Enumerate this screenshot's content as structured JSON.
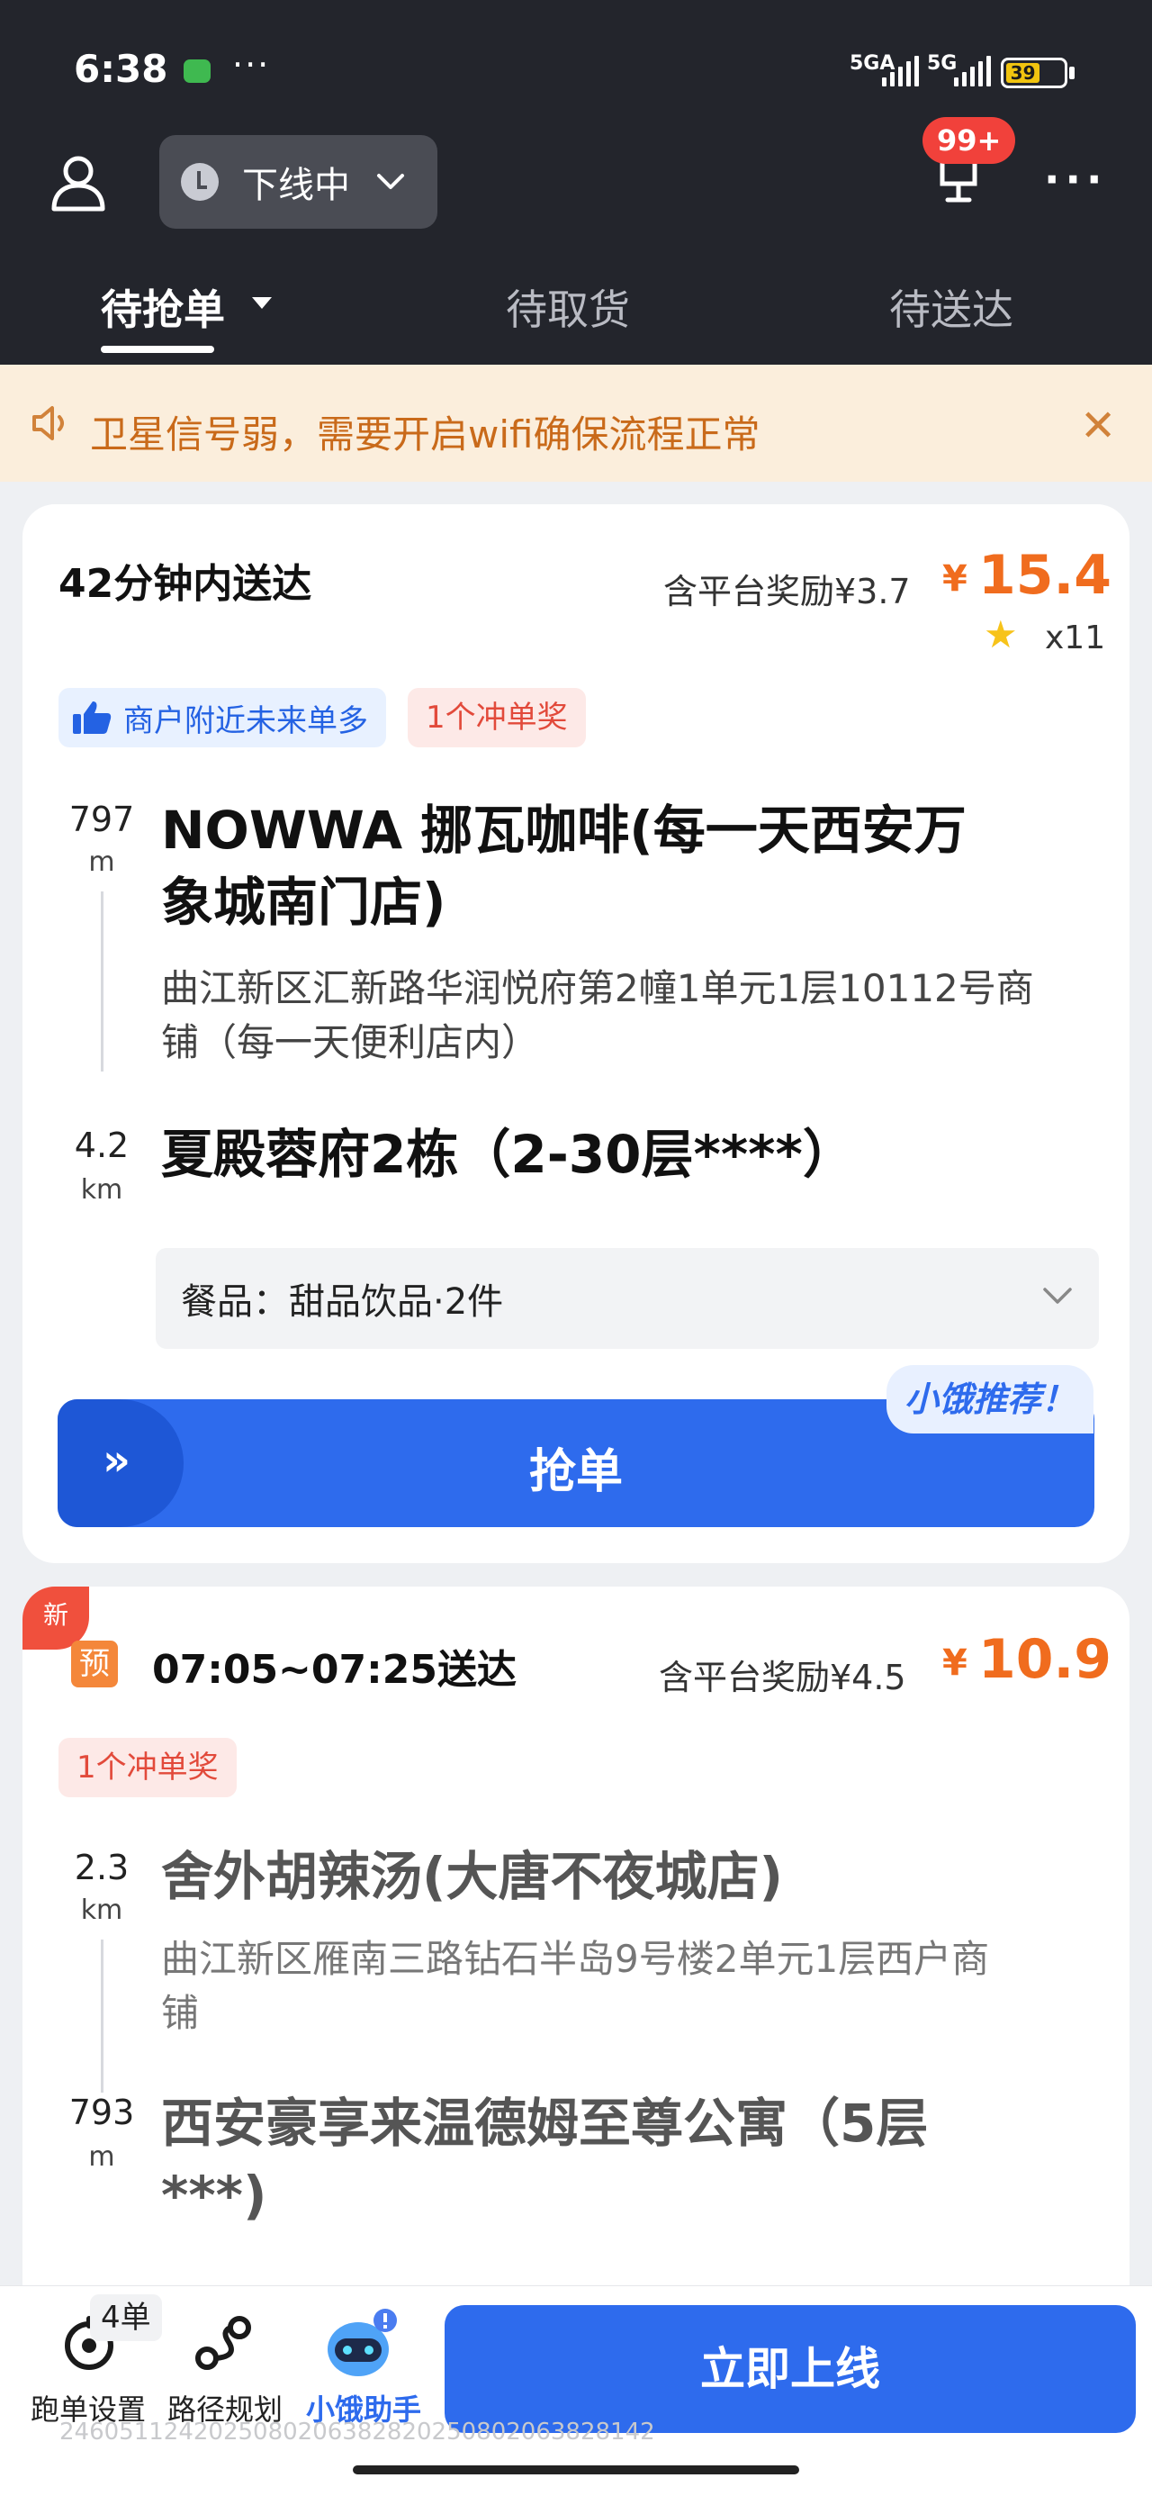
{
  "status_bar": {
    "time": "6:38",
    "dots": "···",
    "net1": "5GA",
    "net2": "5G",
    "battery": "39"
  },
  "header": {
    "status_label": "下线中",
    "badge": "99+",
    "more": "···"
  },
  "tabs": [
    {
      "label": "待抢单"
    },
    {
      "label": "待取货"
    },
    {
      "label": "待送达"
    }
  ],
  "notice": {
    "text": "卫星信号弱，需要开启wifi确保流程正常",
    "close": "✕"
  },
  "orders": [
    {
      "deliver": "42分钟内送达",
      "bonus": "含平台奖励¥3.7",
      "yen": "¥",
      "price": "15.4",
      "stars": "x11",
      "tags": [
        "商户附近未来单多",
        "1个冲单奖"
      ],
      "pickup": {
        "dist": "797",
        "unit": "m",
        "name_line1": "NOWWA 挪瓦咖啡(每一天西安万",
        "name_line2": "象城南门店)",
        "addr_line1": "曲江新区汇新路华润悦府第2幢1单元1层10112号商",
        "addr_line2": "铺（每一天便利店内）"
      },
      "dropoff": {
        "dist": "4.2",
        "unit": "km",
        "name": "夏殿蓉府2栋（2-30层****）"
      },
      "items": "餐品：甜品饮品·2件",
      "grab": "抢单",
      "recommend": "小饿推荐！"
    },
    {
      "new_flag": "新",
      "pre_flag": "预",
      "deliver": "07:05~07:25送达",
      "bonus": "含平台奖励¥4.5",
      "yen": "¥",
      "price": "10.9",
      "tags": [
        "1个冲单奖"
      ],
      "pickup": {
        "dist": "2.3",
        "unit": "km",
        "name": "舍外胡辣汤(大唐不夜城店)",
        "addr_line1": "曲江新区雁南三路钻石半岛9号楼2单元1层西户商",
        "addr_line2": "铺"
      },
      "dropoff": {
        "dist": "793",
        "unit": "m",
        "name_line1": "西安豪享来温德姆至尊公寓（5层",
        "name_line2": "***)"
      }
    }
  ],
  "bottom": {
    "count": "4单",
    "settings": "跑单设置",
    "route": "路径规划",
    "helper": "小饿助手",
    "online": "立即上线",
    "footer_id": "2460511242025080206382820250802063828142"
  },
  "colors": {
    "accent": "#2e6bed",
    "price": "#f06c1e",
    "header_bg": "#23252c",
    "notice_bg": "#fbeedc"
  }
}
